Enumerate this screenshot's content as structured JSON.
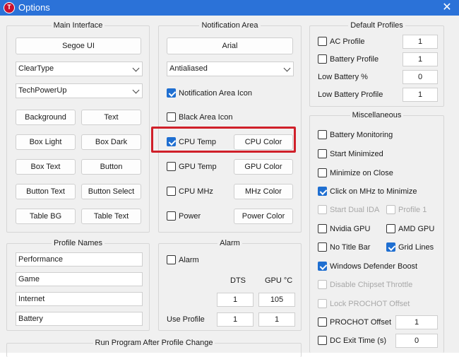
{
  "window": {
    "title": "Options",
    "icon_letter": "T"
  },
  "main_interface": {
    "title": "Main Interface",
    "font_button": "Segoe UI",
    "render_combo": "ClearType",
    "skin_combo": "TechPowerUp",
    "color_buttons": [
      "Background",
      "Text",
      "Box Light",
      "Box Dark",
      "Box Text",
      "Button",
      "Button Text",
      "Button Select",
      "Table BG",
      "Table Text"
    ]
  },
  "notification_area": {
    "title": "Notification Area",
    "font_button": "Arial",
    "aa_combo": "Antialiased",
    "notification_icon": {
      "label": "Notification Area Icon",
      "checked": true
    },
    "black_icon": {
      "label": "Black Area Icon",
      "checked": false
    },
    "rows": [
      {
        "label": "CPU Temp",
        "checked": true,
        "button": "CPU Color"
      },
      {
        "label": "GPU Temp",
        "checked": false,
        "button": "GPU Color"
      },
      {
        "label": "CPU MHz",
        "checked": false,
        "button": "MHz Color"
      },
      {
        "label": "Power",
        "checked": false,
        "button": "Power Color"
      }
    ]
  },
  "default_profiles": {
    "title": "Default Profiles",
    "ac": {
      "label": "AC Profile",
      "value": "1"
    },
    "battery": {
      "label": "Battery Profile",
      "value": "1"
    },
    "low_pct": {
      "label": "Low Battery %",
      "value": "0"
    },
    "low_profile": {
      "label": "Low Battery Profile",
      "value": "1"
    }
  },
  "misc": {
    "title": "Miscellaneous",
    "battery_monitoring": "Battery Monitoring",
    "start_minimized": "Start Minimized",
    "minimize_on_close": "Minimize on Close",
    "click_mhz": "Click on MHz to Minimize",
    "start_dual_ida": "Start Dual IDA",
    "profile1": "Profile 1",
    "nvidia_gpu": "Nvidia GPU",
    "amd_gpu": "AMD GPU",
    "no_title_bar": "No Title Bar",
    "grid_lines": "Grid Lines",
    "defender_boost": "Windows Defender Boost",
    "disable_chipset": "Disable Chipset Throttle",
    "lock_prochot": "Lock PROCHOT Offset",
    "prochot_offset": {
      "label": "PROCHOT Offset",
      "value": "1"
    },
    "dc_exit": {
      "label": "DC Exit Time (s)",
      "value": "0"
    }
  },
  "profile_names": {
    "title": "Profile Names",
    "names": [
      "Performance",
      "Game",
      "Internet",
      "Battery"
    ]
  },
  "alarm": {
    "title": "Alarm",
    "alarm_label": "Alarm",
    "col_dts": "DTS",
    "col_gpu": "GPU °C",
    "threshold_dts": "1",
    "threshold_gpu": "105",
    "use_profile_label": "Use Profile",
    "profile_dts": "1",
    "profile_gpu": "1"
  },
  "run_program": {
    "title": "Run Program After Profile Change"
  }
}
